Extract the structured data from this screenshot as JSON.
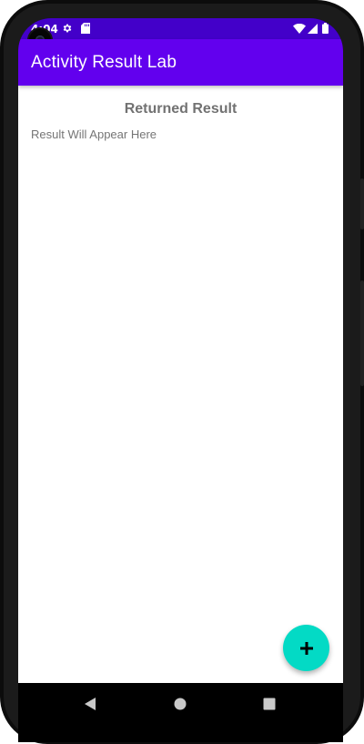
{
  "status_bar": {
    "time": "4:04",
    "icons": [
      "settings-gear-icon",
      "sd-card-icon",
      "wifi-icon",
      "cell-signal-icon",
      "battery-icon"
    ],
    "background_color": "#4300c9"
  },
  "app_bar": {
    "title": "Activity Result Lab",
    "background_color": "#6200ee"
  },
  "content": {
    "heading": "Returned Result",
    "result_text": "Result Will Appear Here"
  },
  "fab": {
    "icon": "plus-icon",
    "color": "#03dac5"
  },
  "nav_bar": {
    "buttons": [
      "back-triangle-icon",
      "home-circle-icon",
      "recents-square-icon"
    ]
  }
}
